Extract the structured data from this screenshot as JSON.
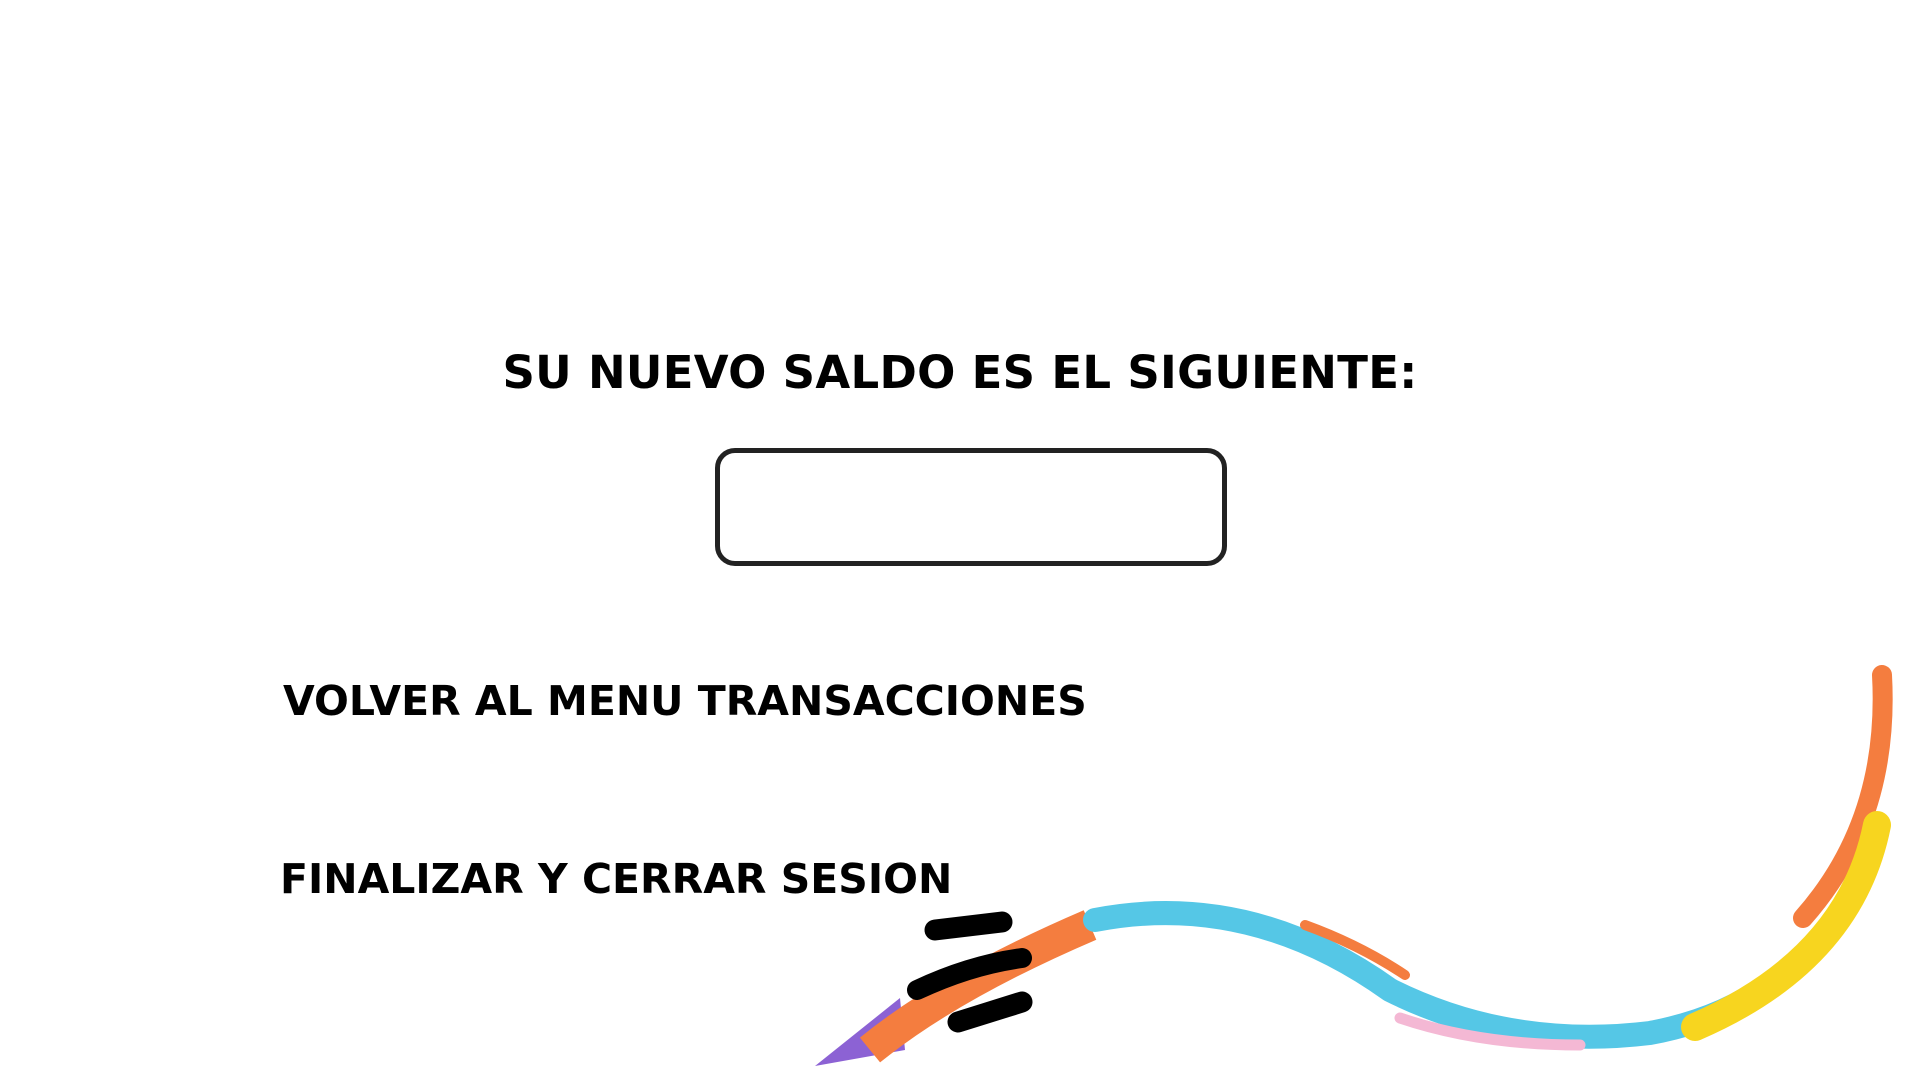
{
  "screen": {
    "title": "SU NUEVO SALDO ES EL SIGUIENTE:",
    "balance_value": ""
  },
  "options": {
    "menu_transacciones": "VOLVER AL MENU TRANSACCIONES",
    "cerrar_sesion": "FINALIZAR Y CERRAR SESION"
  },
  "decoration": {
    "colors": {
      "purple": "#8c62d4",
      "orange": "#f47d3f",
      "cyan": "#55c7e6",
      "pink": "#f4b8d4",
      "yellow": "#f7d51f",
      "black": "#000000"
    }
  }
}
